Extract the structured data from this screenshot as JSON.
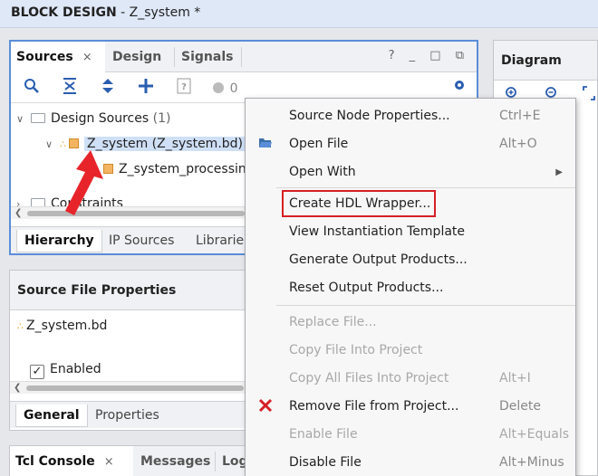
{
  "window": {
    "title_bold": "BLOCK DESIGN",
    "title_rest": " - Z_system *"
  },
  "sources_panel": {
    "tabs": [
      "Sources",
      "Design",
      "Signals"
    ],
    "tab_close": "×",
    "window_buttons": "? _ □ ⧉",
    "toolbar_count": "0",
    "tree": {
      "design_sources": "Design Sources",
      "design_sources_count": "(1)",
      "z_system": "Z_system (Z_system.bd)",
      "z_system_processing": "Z_system_processing",
      "constraints": "Constraints"
    },
    "bottom_tabs": [
      "Hierarchy",
      "IP Sources",
      "Librarie"
    ]
  },
  "source_file_properties": {
    "title": "Source File Properties",
    "file_name": "Z_system.bd",
    "enabled_label": "Enabled",
    "bottom_tabs": [
      "General",
      "Properties"
    ]
  },
  "tcl_panel": {
    "tabs": [
      "Tcl Console",
      "Messages",
      "Log"
    ]
  },
  "diagram_panel": {
    "title": "Diagram"
  },
  "context_menu": {
    "items": [
      {
        "label": "Source Node Properties...",
        "shortcut": "Ctrl+E",
        "disabled": false
      },
      {
        "label": "Open File",
        "shortcut": "Alt+O",
        "disabled": false
      },
      {
        "label": "Open With",
        "shortcut": "",
        "disabled": false
      },
      {
        "label": "Create HDL Wrapper...",
        "shortcut": "",
        "disabled": false
      },
      {
        "label": "View Instantiation Template",
        "shortcut": "",
        "disabled": false
      },
      {
        "label": "Generate Output Products...",
        "shortcut": "",
        "disabled": false
      },
      {
        "label": "Reset Output Products...",
        "shortcut": "",
        "disabled": false
      },
      {
        "label": "Replace File...",
        "shortcut": "",
        "disabled": true
      },
      {
        "label": "Copy File Into Project",
        "shortcut": "",
        "disabled": true
      },
      {
        "label": "Copy All Files Into Project",
        "shortcut": "Alt+I",
        "disabled": true
      },
      {
        "label": "Remove File from Project...",
        "shortcut": "Delete",
        "disabled": false
      },
      {
        "label": "Enable File",
        "shortcut": "Alt+Equals",
        "disabled": true
      },
      {
        "label": "Disable File",
        "shortcut": "Alt+Minus",
        "disabled": false
      }
    ]
  },
  "colors": {
    "highlight_box": "#d61f26",
    "arrow": "#e8242b",
    "selection": "#cfe0f6",
    "panel_border_active": "#5b8dd9"
  },
  "icons": [
    "search-icon",
    "collapse-all-icon",
    "expand-all-icon",
    "add-icon",
    "properties-icon",
    "gear-icon",
    "folder-open-icon",
    "delete-x-icon",
    "submenu-arrow-icon"
  ]
}
